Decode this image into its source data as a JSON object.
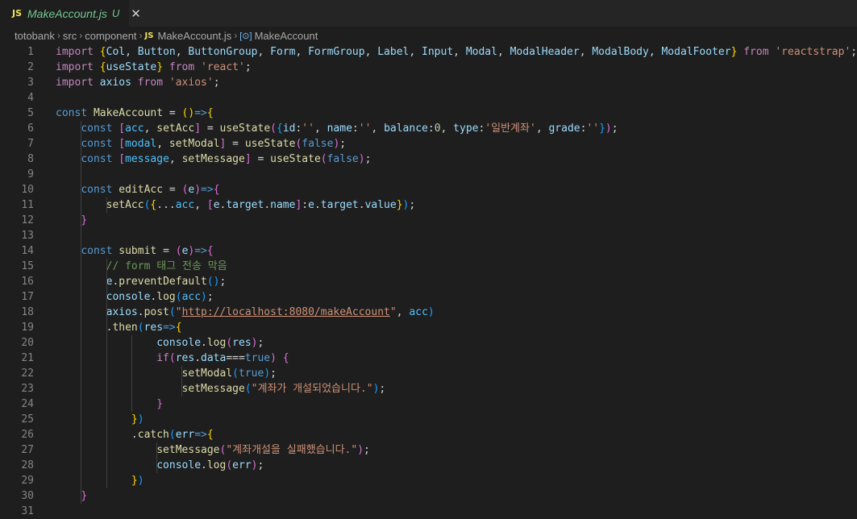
{
  "tab": {
    "icon": "JS",
    "filename": "MakeAccount.js",
    "status": "U",
    "close": "✕"
  },
  "breadcrumbs": {
    "items": [
      "totobank",
      "src",
      "component"
    ],
    "file_icon": "JS",
    "file": "MakeAccount.js",
    "symbol_icon": "[⊙]",
    "symbol": "MakeAccount"
  },
  "code_lines": [
    {
      "n": "1",
      "guides": [],
      "tokens": [
        [
          "import ",
          "ctl"
        ],
        [
          "{",
          "b1"
        ],
        [
          "Col",
          "var"
        ],
        [
          ", ",
          "p"
        ],
        [
          "Button",
          "var"
        ],
        [
          ", ",
          "p"
        ],
        [
          "ButtonGroup",
          "var"
        ],
        [
          ", ",
          "p"
        ],
        [
          "Form",
          "var"
        ],
        [
          ", ",
          "p"
        ],
        [
          "FormGroup",
          "var"
        ],
        [
          ", ",
          "p"
        ],
        [
          "Label",
          "var"
        ],
        [
          ", ",
          "p"
        ],
        [
          "Input",
          "var"
        ],
        [
          ", ",
          "p"
        ],
        [
          "Modal",
          "var"
        ],
        [
          ", ",
          "p"
        ],
        [
          "ModalHeader",
          "var"
        ],
        [
          ", ",
          "p"
        ],
        [
          "ModalBody",
          "var"
        ],
        [
          ", ",
          "p"
        ],
        [
          "ModalFooter",
          "var"
        ],
        [
          "}",
          "b1"
        ],
        [
          " from ",
          "ctl"
        ],
        [
          "'reactstrap'",
          "str"
        ],
        [
          ";",
          "p"
        ]
      ]
    },
    {
      "n": "2",
      "guides": [],
      "tokens": [
        [
          "import ",
          "ctl"
        ],
        [
          "{",
          "b1"
        ],
        [
          "useState",
          "var"
        ],
        [
          "}",
          "b1"
        ],
        [
          " from ",
          "ctl"
        ],
        [
          "'react'",
          "str"
        ],
        [
          ";",
          "p"
        ]
      ]
    },
    {
      "n": "3",
      "guides": [],
      "tokens": [
        [
          "import ",
          "ctl"
        ],
        [
          "axios",
          "var"
        ],
        [
          " from ",
          "ctl"
        ],
        [
          "'axios'",
          "str"
        ],
        [
          ";",
          "p"
        ]
      ]
    },
    {
      "n": "4",
      "guides": [],
      "tokens": []
    },
    {
      "n": "5",
      "guides": [],
      "tokens": [
        [
          "const ",
          "kw"
        ],
        [
          "MakeAccount",
          "fn"
        ],
        [
          " = ",
          "p"
        ],
        [
          "()",
          "b1"
        ],
        [
          "=>",
          "kw"
        ],
        [
          "{",
          "b1"
        ]
      ]
    },
    {
      "n": "6",
      "guides": [
        0
      ],
      "tokens": [
        [
          "    ",
          "p"
        ],
        [
          "const ",
          "kw"
        ],
        [
          "[",
          "b2"
        ],
        [
          "acc",
          "cst"
        ],
        [
          ", ",
          "p"
        ],
        [
          "setAcc",
          "fn"
        ],
        [
          "]",
          "b2"
        ],
        [
          " = ",
          "p"
        ],
        [
          "useState",
          "fn"
        ],
        [
          "(",
          "b2"
        ],
        [
          "{",
          "b3"
        ],
        [
          "id",
          "var"
        ],
        [
          ":",
          "p"
        ],
        [
          "''",
          "str"
        ],
        [
          ", ",
          "p"
        ],
        [
          "name",
          "var"
        ],
        [
          ":",
          "p"
        ],
        [
          "''",
          "str"
        ],
        [
          ", ",
          "p"
        ],
        [
          "balance",
          "var"
        ],
        [
          ":",
          "p"
        ],
        [
          "0",
          "num"
        ],
        [
          ", ",
          "p"
        ],
        [
          "type",
          "var"
        ],
        [
          ":",
          "p"
        ],
        [
          "'일반계좌'",
          "str"
        ],
        [
          ", ",
          "p"
        ],
        [
          "grade",
          "var"
        ],
        [
          ":",
          "p"
        ],
        [
          "''",
          "str"
        ],
        [
          "}",
          "b3"
        ],
        [
          ")",
          "b2"
        ],
        [
          ";",
          "p"
        ]
      ]
    },
    {
      "n": "7",
      "guides": [
        0
      ],
      "tokens": [
        [
          "    ",
          "p"
        ],
        [
          "const ",
          "kw"
        ],
        [
          "[",
          "b2"
        ],
        [
          "modal",
          "cst"
        ],
        [
          ", ",
          "p"
        ],
        [
          "setModal",
          "fn"
        ],
        [
          "]",
          "b2"
        ],
        [
          " = ",
          "p"
        ],
        [
          "useState",
          "fn"
        ],
        [
          "(",
          "b2"
        ],
        [
          "false",
          "kw"
        ],
        [
          ")",
          "b2"
        ],
        [
          ";",
          "p"
        ]
      ]
    },
    {
      "n": "8",
      "guides": [
        0
      ],
      "tokens": [
        [
          "    ",
          "p"
        ],
        [
          "const ",
          "kw"
        ],
        [
          "[",
          "b2"
        ],
        [
          "message",
          "cst"
        ],
        [
          ", ",
          "p"
        ],
        [
          "setMessage",
          "fn"
        ],
        [
          "]",
          "b2"
        ],
        [
          " = ",
          "p"
        ],
        [
          "useState",
          "fn"
        ],
        [
          "(",
          "b2"
        ],
        [
          "false",
          "kw"
        ],
        [
          ")",
          "b2"
        ],
        [
          ";",
          "p"
        ]
      ]
    },
    {
      "n": "9",
      "guides": [
        0
      ],
      "tokens": []
    },
    {
      "n": "10",
      "guides": [
        0
      ],
      "tokens": [
        [
          "    ",
          "p"
        ],
        [
          "const ",
          "kw"
        ],
        [
          "editAcc",
          "fn"
        ],
        [
          " = ",
          "p"
        ],
        [
          "(",
          "b2"
        ],
        [
          "e",
          "var"
        ],
        [
          ")",
          "b2"
        ],
        [
          "=>",
          "kw"
        ],
        [
          "{",
          "b2"
        ]
      ]
    },
    {
      "n": "11",
      "guides": [
        0,
        1
      ],
      "tokens": [
        [
          "        ",
          "p"
        ],
        [
          "setAcc",
          "fn"
        ],
        [
          "(",
          "b3"
        ],
        [
          "{",
          "b1"
        ],
        [
          "...",
          "p"
        ],
        [
          "acc",
          "cst"
        ],
        [
          ", ",
          "p"
        ],
        [
          "[",
          "b2"
        ],
        [
          "e",
          "var"
        ],
        [
          ".",
          "p"
        ],
        [
          "target",
          "var"
        ],
        [
          ".",
          "p"
        ],
        [
          "name",
          "var"
        ],
        [
          "]",
          "b2"
        ],
        [
          ":",
          "p"
        ],
        [
          "e",
          "var"
        ],
        [
          ".",
          "p"
        ],
        [
          "target",
          "var"
        ],
        [
          ".",
          "p"
        ],
        [
          "value",
          "var"
        ],
        [
          "}",
          "b1"
        ],
        [
          ")",
          "b3"
        ],
        [
          ";",
          "p"
        ]
      ]
    },
    {
      "n": "12",
      "guides": [
        0
      ],
      "tokens": [
        [
          "    ",
          "p"
        ],
        [
          "}",
          "b2"
        ]
      ]
    },
    {
      "n": "13",
      "guides": [
        0
      ],
      "tokens": []
    },
    {
      "n": "14",
      "guides": [
        0
      ],
      "tokens": [
        [
          "    ",
          "p"
        ],
        [
          "const ",
          "kw"
        ],
        [
          "submit",
          "fn"
        ],
        [
          " = ",
          "p"
        ],
        [
          "(",
          "b2"
        ],
        [
          "e",
          "var"
        ],
        [
          ")",
          "b2"
        ],
        [
          "=>",
          "kw"
        ],
        [
          "{",
          "b2"
        ]
      ]
    },
    {
      "n": "15",
      "guides": [
        0,
        1
      ],
      "tokens": [
        [
          "        ",
          "p"
        ],
        [
          "// form 태그 전송 막음",
          "cm"
        ]
      ]
    },
    {
      "n": "16",
      "guides": [
        0,
        1
      ],
      "tokens": [
        [
          "        ",
          "p"
        ],
        [
          "e",
          "var"
        ],
        [
          ".",
          "p"
        ],
        [
          "preventDefault",
          "fn"
        ],
        [
          "()",
          "b3"
        ],
        [
          ";",
          "p"
        ]
      ]
    },
    {
      "n": "17",
      "guides": [
        0,
        1
      ],
      "tokens": [
        [
          "        ",
          "p"
        ],
        [
          "console",
          "var"
        ],
        [
          ".",
          "p"
        ],
        [
          "log",
          "fn"
        ],
        [
          "(",
          "b3"
        ],
        [
          "acc",
          "cst"
        ],
        [
          ")",
          "b3"
        ],
        [
          ";",
          "p"
        ]
      ]
    },
    {
      "n": "18",
      "guides": [
        0,
        1
      ],
      "tokens": [
        [
          "        ",
          "p"
        ],
        [
          "axios",
          "var"
        ],
        [
          ".",
          "p"
        ],
        [
          "post",
          "fn"
        ],
        [
          "(",
          "b3"
        ],
        [
          "\"",
          "str"
        ],
        [
          "http://localhost:8080/makeAccount",
          "str url"
        ],
        [
          "\"",
          "str"
        ],
        [
          ", ",
          "p"
        ],
        [
          "acc",
          "cst"
        ],
        [
          ")",
          "b3"
        ]
      ]
    },
    {
      "n": "19",
      "guides": [
        0,
        1
      ],
      "tokens": [
        [
          "        ",
          "p"
        ],
        [
          ".",
          "p"
        ],
        [
          "then",
          "fn"
        ],
        [
          "(",
          "b3"
        ],
        [
          "res",
          "var"
        ],
        [
          "=>",
          "kw"
        ],
        [
          "{",
          "b1"
        ]
      ]
    },
    {
      "n": "20",
      "guides": [
        0,
        1,
        2
      ],
      "tokens": [
        [
          "                ",
          "p"
        ],
        [
          "console",
          "var"
        ],
        [
          ".",
          "p"
        ],
        [
          "log",
          "fn"
        ],
        [
          "(",
          "b2"
        ],
        [
          "res",
          "var"
        ],
        [
          ")",
          "b2"
        ],
        [
          ";",
          "p"
        ]
      ]
    },
    {
      "n": "21",
      "guides": [
        0,
        1,
        2
      ],
      "tokens": [
        [
          "                ",
          "p"
        ],
        [
          "if",
          "ctl"
        ],
        [
          "(",
          "b2"
        ],
        [
          "res",
          "var"
        ],
        [
          ".",
          "p"
        ],
        [
          "data",
          "var"
        ],
        [
          "===",
          "p"
        ],
        [
          "true",
          "kw"
        ],
        [
          ")",
          "b2"
        ],
        [
          " ",
          "p"
        ],
        [
          "{",
          "b2"
        ]
      ]
    },
    {
      "n": "22",
      "guides": [
        0,
        1,
        2,
        4
      ],
      "tokens": [
        [
          "                    ",
          "p"
        ],
        [
          "setModal",
          "fn"
        ],
        [
          "(",
          "b3"
        ],
        [
          "true",
          "kw"
        ],
        [
          ")",
          "b3"
        ],
        [
          ";",
          "p"
        ]
      ]
    },
    {
      "n": "23",
      "guides": [
        0,
        1,
        2,
        4
      ],
      "tokens": [
        [
          "                    ",
          "p"
        ],
        [
          "setMessage",
          "fn"
        ],
        [
          "(",
          "b3"
        ],
        [
          "\"계좌가 개설되었습니다.\"",
          "str"
        ],
        [
          ")",
          "b3"
        ],
        [
          ";",
          "p"
        ]
      ]
    },
    {
      "n": "24",
      "guides": [
        0,
        1,
        2
      ],
      "tokens": [
        [
          "                ",
          "p"
        ],
        [
          "}",
          "b2"
        ]
      ]
    },
    {
      "n": "25",
      "guides": [
        0,
        1
      ],
      "tokens": [
        [
          "            ",
          "p"
        ],
        [
          "}",
          "b1"
        ],
        [
          ")",
          "b3"
        ]
      ]
    },
    {
      "n": "26",
      "guides": [
        0,
        1
      ],
      "tokens": [
        [
          "            ",
          "p"
        ],
        [
          ".",
          "p"
        ],
        [
          "catch",
          "fn"
        ],
        [
          "(",
          "b3"
        ],
        [
          "err",
          "var"
        ],
        [
          "=>",
          "kw"
        ],
        [
          "{",
          "b1"
        ]
      ]
    },
    {
      "n": "27",
      "guides": [
        0,
        1,
        3
      ],
      "tokens": [
        [
          "                ",
          "p"
        ],
        [
          "setMessage",
          "fn"
        ],
        [
          "(",
          "b2"
        ],
        [
          "\"계좌개설을 실패했습니다.\"",
          "str"
        ],
        [
          ")",
          "b2"
        ],
        [
          ";",
          "p"
        ]
      ]
    },
    {
      "n": "28",
      "guides": [
        0,
        1,
        3
      ],
      "tokens": [
        [
          "                ",
          "p"
        ],
        [
          "console",
          "var"
        ],
        [
          ".",
          "p"
        ],
        [
          "log",
          "fn"
        ],
        [
          "(",
          "b2"
        ],
        [
          "err",
          "var"
        ],
        [
          ")",
          "b2"
        ],
        [
          ";",
          "p"
        ]
      ]
    },
    {
      "n": "29",
      "guides": [
        0,
        1
      ],
      "tokens": [
        [
          "            ",
          "p"
        ],
        [
          "}",
          "b1"
        ],
        [
          ")",
          "b3"
        ]
      ]
    },
    {
      "n": "30",
      "guides": [
        0
      ],
      "tokens": [
        [
          "    ",
          "p"
        ],
        [
          "}",
          "b2"
        ]
      ]
    },
    {
      "n": "31",
      "guides": [],
      "tokens": []
    }
  ]
}
